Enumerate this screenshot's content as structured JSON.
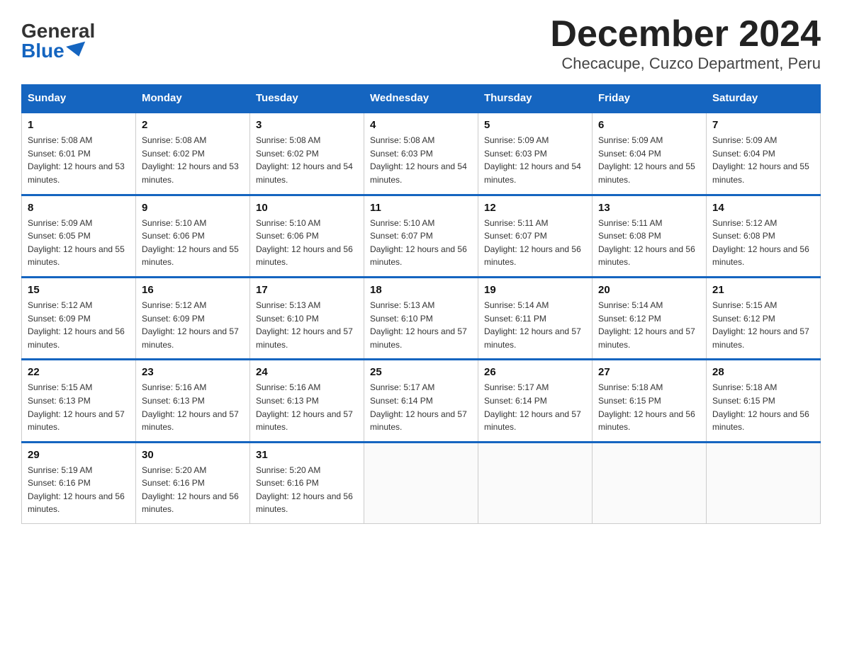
{
  "header": {
    "logo_general": "General",
    "logo_blue": "Blue",
    "title": "December 2024",
    "subtitle": "Checacupe, Cuzco Department, Peru"
  },
  "calendar": {
    "days_of_week": [
      "Sunday",
      "Monday",
      "Tuesday",
      "Wednesday",
      "Thursday",
      "Friday",
      "Saturday"
    ],
    "weeks": [
      [
        {
          "day": "1",
          "sunrise": "5:08 AM",
          "sunset": "6:01 PM",
          "daylight": "12 hours and 53 minutes."
        },
        {
          "day": "2",
          "sunrise": "5:08 AM",
          "sunset": "6:02 PM",
          "daylight": "12 hours and 53 minutes."
        },
        {
          "day": "3",
          "sunrise": "5:08 AM",
          "sunset": "6:02 PM",
          "daylight": "12 hours and 54 minutes."
        },
        {
          "day": "4",
          "sunrise": "5:08 AM",
          "sunset": "6:03 PM",
          "daylight": "12 hours and 54 minutes."
        },
        {
          "day": "5",
          "sunrise": "5:09 AM",
          "sunset": "6:03 PM",
          "daylight": "12 hours and 54 minutes."
        },
        {
          "day": "6",
          "sunrise": "5:09 AM",
          "sunset": "6:04 PM",
          "daylight": "12 hours and 55 minutes."
        },
        {
          "day": "7",
          "sunrise": "5:09 AM",
          "sunset": "6:04 PM",
          "daylight": "12 hours and 55 minutes."
        }
      ],
      [
        {
          "day": "8",
          "sunrise": "5:09 AM",
          "sunset": "6:05 PM",
          "daylight": "12 hours and 55 minutes."
        },
        {
          "day": "9",
          "sunrise": "5:10 AM",
          "sunset": "6:06 PM",
          "daylight": "12 hours and 55 minutes."
        },
        {
          "day": "10",
          "sunrise": "5:10 AM",
          "sunset": "6:06 PM",
          "daylight": "12 hours and 56 minutes."
        },
        {
          "day": "11",
          "sunrise": "5:10 AM",
          "sunset": "6:07 PM",
          "daylight": "12 hours and 56 minutes."
        },
        {
          "day": "12",
          "sunrise": "5:11 AM",
          "sunset": "6:07 PM",
          "daylight": "12 hours and 56 minutes."
        },
        {
          "day": "13",
          "sunrise": "5:11 AM",
          "sunset": "6:08 PM",
          "daylight": "12 hours and 56 minutes."
        },
        {
          "day": "14",
          "sunrise": "5:12 AM",
          "sunset": "6:08 PM",
          "daylight": "12 hours and 56 minutes."
        }
      ],
      [
        {
          "day": "15",
          "sunrise": "5:12 AM",
          "sunset": "6:09 PM",
          "daylight": "12 hours and 56 minutes."
        },
        {
          "day": "16",
          "sunrise": "5:12 AM",
          "sunset": "6:09 PM",
          "daylight": "12 hours and 57 minutes."
        },
        {
          "day": "17",
          "sunrise": "5:13 AM",
          "sunset": "6:10 PM",
          "daylight": "12 hours and 57 minutes."
        },
        {
          "day": "18",
          "sunrise": "5:13 AM",
          "sunset": "6:10 PM",
          "daylight": "12 hours and 57 minutes."
        },
        {
          "day": "19",
          "sunrise": "5:14 AM",
          "sunset": "6:11 PM",
          "daylight": "12 hours and 57 minutes."
        },
        {
          "day": "20",
          "sunrise": "5:14 AM",
          "sunset": "6:12 PM",
          "daylight": "12 hours and 57 minutes."
        },
        {
          "day": "21",
          "sunrise": "5:15 AM",
          "sunset": "6:12 PM",
          "daylight": "12 hours and 57 minutes."
        }
      ],
      [
        {
          "day": "22",
          "sunrise": "5:15 AM",
          "sunset": "6:13 PM",
          "daylight": "12 hours and 57 minutes."
        },
        {
          "day": "23",
          "sunrise": "5:16 AM",
          "sunset": "6:13 PM",
          "daylight": "12 hours and 57 minutes."
        },
        {
          "day": "24",
          "sunrise": "5:16 AM",
          "sunset": "6:13 PM",
          "daylight": "12 hours and 57 minutes."
        },
        {
          "day": "25",
          "sunrise": "5:17 AM",
          "sunset": "6:14 PM",
          "daylight": "12 hours and 57 minutes."
        },
        {
          "day": "26",
          "sunrise": "5:17 AM",
          "sunset": "6:14 PM",
          "daylight": "12 hours and 57 minutes."
        },
        {
          "day": "27",
          "sunrise": "5:18 AM",
          "sunset": "6:15 PM",
          "daylight": "12 hours and 56 minutes."
        },
        {
          "day": "28",
          "sunrise": "5:18 AM",
          "sunset": "6:15 PM",
          "daylight": "12 hours and 56 minutes."
        }
      ],
      [
        {
          "day": "29",
          "sunrise": "5:19 AM",
          "sunset": "6:16 PM",
          "daylight": "12 hours and 56 minutes."
        },
        {
          "day": "30",
          "sunrise": "5:20 AM",
          "sunset": "6:16 PM",
          "daylight": "12 hours and 56 minutes."
        },
        {
          "day": "31",
          "sunrise": "5:20 AM",
          "sunset": "6:16 PM",
          "daylight": "12 hours and 56 minutes."
        },
        null,
        null,
        null,
        null
      ]
    ]
  }
}
